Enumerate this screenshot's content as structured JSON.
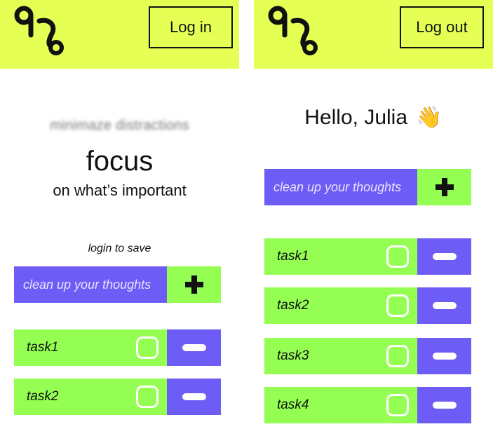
{
  "colors": {
    "header_bg": "#e6ff55",
    "accent_purple": "#6e5cf6",
    "accent_green": "#94ff52",
    "text": "#111111"
  },
  "left_screen": {
    "header": {
      "logo_icon": "logo-icon",
      "auth_label": "Log in"
    },
    "tagline": "minimaze distractions",
    "title": "focus",
    "subtitle": "on what’s important",
    "login_hint": "login to save",
    "input": {
      "placeholder": "clean up your thoughts",
      "add_icon": "plus-icon"
    },
    "tasks": [
      {
        "label": "task1"
      },
      {
        "label": "task2"
      }
    ]
  },
  "right_screen": {
    "header": {
      "logo_icon": "logo-icon",
      "auth_label": "Log out"
    },
    "greeting": "Hello, Julia",
    "greeting_emoji": "👋",
    "input": {
      "placeholder": "clean up your thoughts",
      "add_icon": "plus-icon"
    },
    "tasks": [
      {
        "label": "task1"
      },
      {
        "label": "task2"
      },
      {
        "label": "task3"
      },
      {
        "label": "task4"
      }
    ]
  }
}
